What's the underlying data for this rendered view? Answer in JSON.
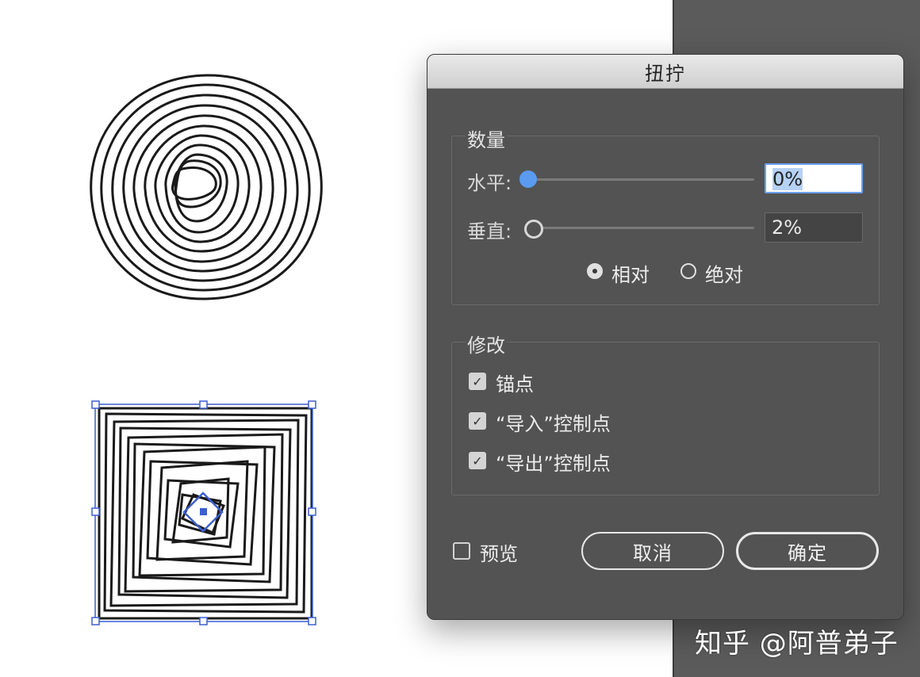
{
  "dialog": {
    "title": "扭拧",
    "amount_group": {
      "label": "数量",
      "horizontal": {
        "label": "水平:",
        "value": "0%"
      },
      "vertical": {
        "label": "垂直:",
        "value": "2%"
      },
      "mode_options": [
        {
          "label": "相对",
          "selected": true
        },
        {
          "label": "绝对",
          "selected": false
        }
      ]
    },
    "modify_group": {
      "label": "修改",
      "options": [
        {
          "label": "锚点",
          "checked": true
        },
        {
          "label": "“导入”控制点",
          "checked": true
        },
        {
          "label": "“导出”控制点",
          "checked": true
        }
      ]
    },
    "preview": {
      "label": "预览",
      "checked": false
    },
    "cancel_label": "取消",
    "ok_label": "确定"
  },
  "watermark": "知乎 @阿普弟子",
  "colors": {
    "accent": "#5a9bf0",
    "dialog_bg": "#535353",
    "selection": "#3b5fd0"
  }
}
